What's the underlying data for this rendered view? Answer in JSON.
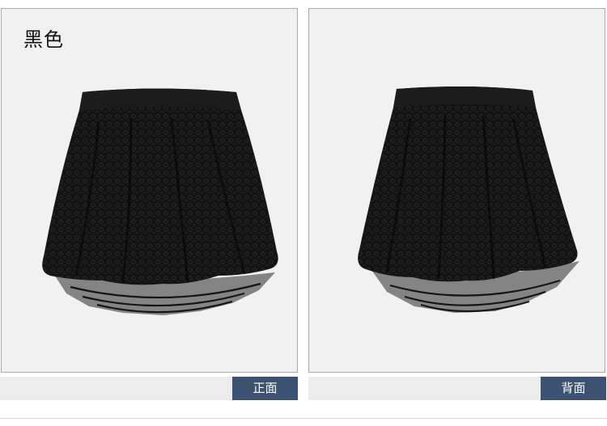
{
  "color_label": "黑色",
  "views": [
    {
      "caption": "正面"
    },
    {
      "caption": "背面"
    }
  ],
  "colors": {
    "panel_bg": "#f1f1f1",
    "caption_bar_bg": "#ececec",
    "caption_tag_bg": "#3d5170",
    "caption_text": "#ffffff",
    "skirt": "#121212"
  }
}
